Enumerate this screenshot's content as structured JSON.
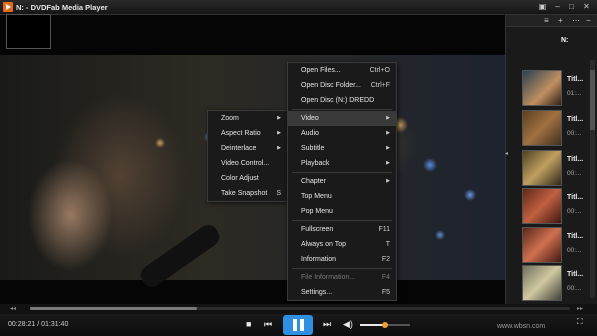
{
  "window": {
    "title": "N: - DVDFab Media Player"
  },
  "menu_main": [
    {
      "label": "Open Files...",
      "shortcut": "Ctrl+O"
    },
    {
      "label": "Open Disc Folder...",
      "shortcut": "Ctrl+F"
    },
    {
      "label": "Open Disc (N:) DREDD",
      "shortcut": ""
    },
    {
      "label": "Video",
      "submenu": true
    },
    {
      "label": "Audio",
      "submenu": true
    },
    {
      "label": "Subtitle",
      "submenu": true
    },
    {
      "label": "Playback",
      "submenu": true
    },
    {
      "label": "Chapter",
      "submenu": true
    },
    {
      "label": "Top Menu",
      "shortcut": ""
    },
    {
      "label": "Pop Menu",
      "shortcut": ""
    },
    {
      "label": "Fullscreen",
      "shortcut": "F11"
    },
    {
      "label": "Always on Top",
      "shortcut": "T"
    },
    {
      "label": "Information",
      "shortcut": "F2"
    },
    {
      "label": "File Information...",
      "shortcut": "F4"
    },
    {
      "label": "Settings...",
      "shortcut": "F5"
    }
  ],
  "menu_video": [
    {
      "label": "Zoom",
      "submenu": true
    },
    {
      "label": "Aspect Ratio",
      "submenu": true
    },
    {
      "label": "Deinterlace",
      "submenu": true
    },
    {
      "label": "Video Control...",
      "shortcut": ""
    },
    {
      "label": "Color Adjust",
      "shortcut": ""
    },
    {
      "label": "Take Snapshot",
      "shortcut": "S"
    }
  ],
  "controls": {
    "time": "00:28:21 / 01:31:40",
    "progress": 0.31,
    "volume": 0.5
  },
  "playlist": {
    "current_label": "N:",
    "items": [
      {
        "title": "Titl...",
        "duration": "01:..."
      },
      {
        "title": "Titl...",
        "duration": "00:..."
      },
      {
        "title": "Titl...",
        "duration": "00:..."
      },
      {
        "title": "Titl...",
        "duration": "00:..."
      },
      {
        "title": "Titl...",
        "duration": "00:..."
      },
      {
        "title": "Titl...",
        "duration": "00:..."
      }
    ]
  },
  "watermark": "www.wbsn.com"
}
